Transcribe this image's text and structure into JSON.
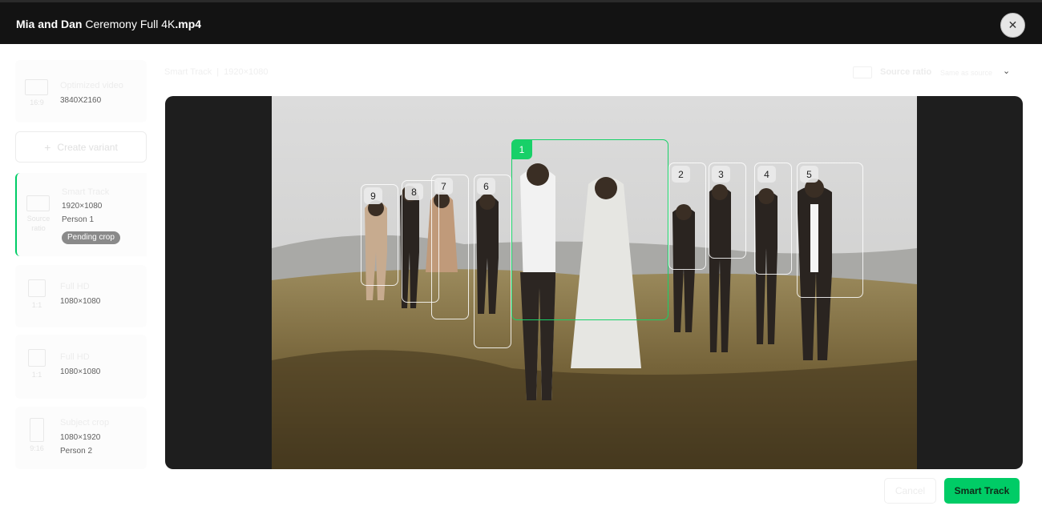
{
  "header": {
    "title_bold": "Mia and Dan",
    "title_rest": " Ceremony Full 4K",
    "title_ext": ".mp4",
    "close_icon": "close-icon"
  },
  "sidebar": {
    "create_label": "Create variant",
    "variants": [
      {
        "ratio": "16:9",
        "name": "Optimized video",
        "resolution": "3840X2160",
        "person": ""
      },
      {
        "ratio": "Source ratio",
        "name": "Smart Track",
        "resolution": "1920×1080",
        "person": "Person 1",
        "badge": "Pending crop"
      },
      {
        "ratio": "1:1",
        "name": "Full HD",
        "resolution": "1080×1080",
        "person": ""
      },
      {
        "ratio": "1:1",
        "name": "Full HD",
        "resolution": "1080×1080",
        "person": ""
      },
      {
        "ratio": "9:16",
        "name": "Subject crop",
        "resolution": "1080×1920",
        "person": "Person 2"
      }
    ]
  },
  "toolbar": {
    "mode": "Smart Track",
    "resolution": "1920×1080",
    "ratio_label": "Source ratio",
    "ratio_value": "Same as source",
    "chevron_icon": "chevron-down-icon"
  },
  "tracking": {
    "selected": "1",
    "people": [
      "1",
      "2",
      "3",
      "4",
      "5",
      "6",
      "7",
      "8",
      "9"
    ]
  },
  "footer": {
    "cancel_label": "Cancel",
    "smart_track_label": "Smart Track"
  },
  "colors": {
    "accent": "#00cc66",
    "header_bg": "#131313",
    "player_bg": "#1e1e1e"
  }
}
